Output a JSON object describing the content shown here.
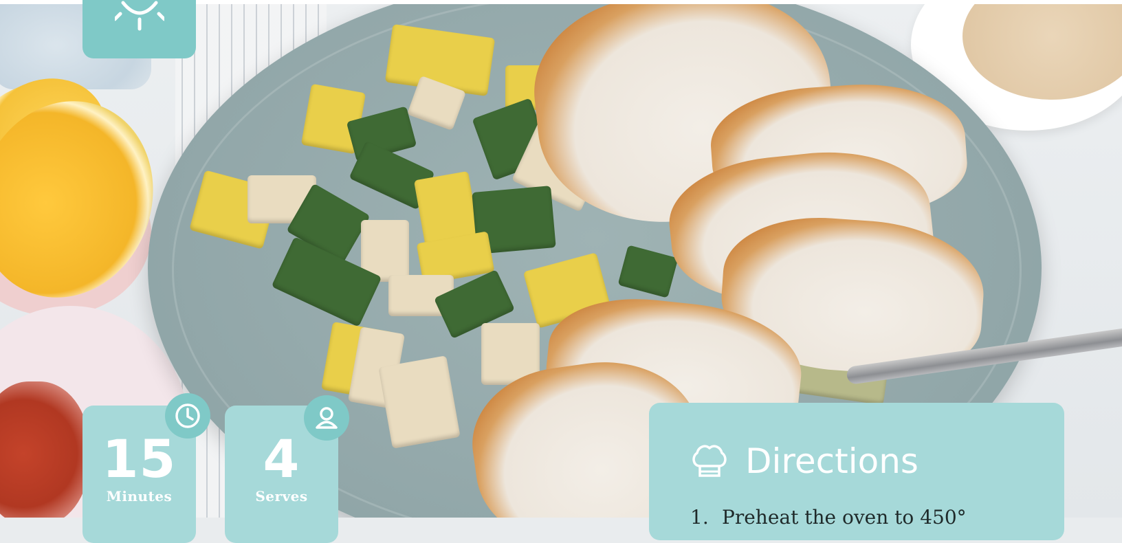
{
  "colors": {
    "tile_teal": "#7fc9c7",
    "card_teal": "#a6d9d9",
    "text_light": "#ffffff",
    "text_dark": "#1f2a2a"
  },
  "top_tile": {
    "icon": "sun-icon"
  },
  "stats": [
    {
      "icon": "clock-icon",
      "value": "15",
      "label": "Minutes"
    },
    {
      "icon": "person-icon",
      "value": "4",
      "label": "Serves"
    }
  ],
  "directions": {
    "icon": "chef-hat-icon",
    "title": "Directions",
    "steps": [
      {
        "number": "1.",
        "text": "Preheat the oven to 450°"
      }
    ]
  }
}
